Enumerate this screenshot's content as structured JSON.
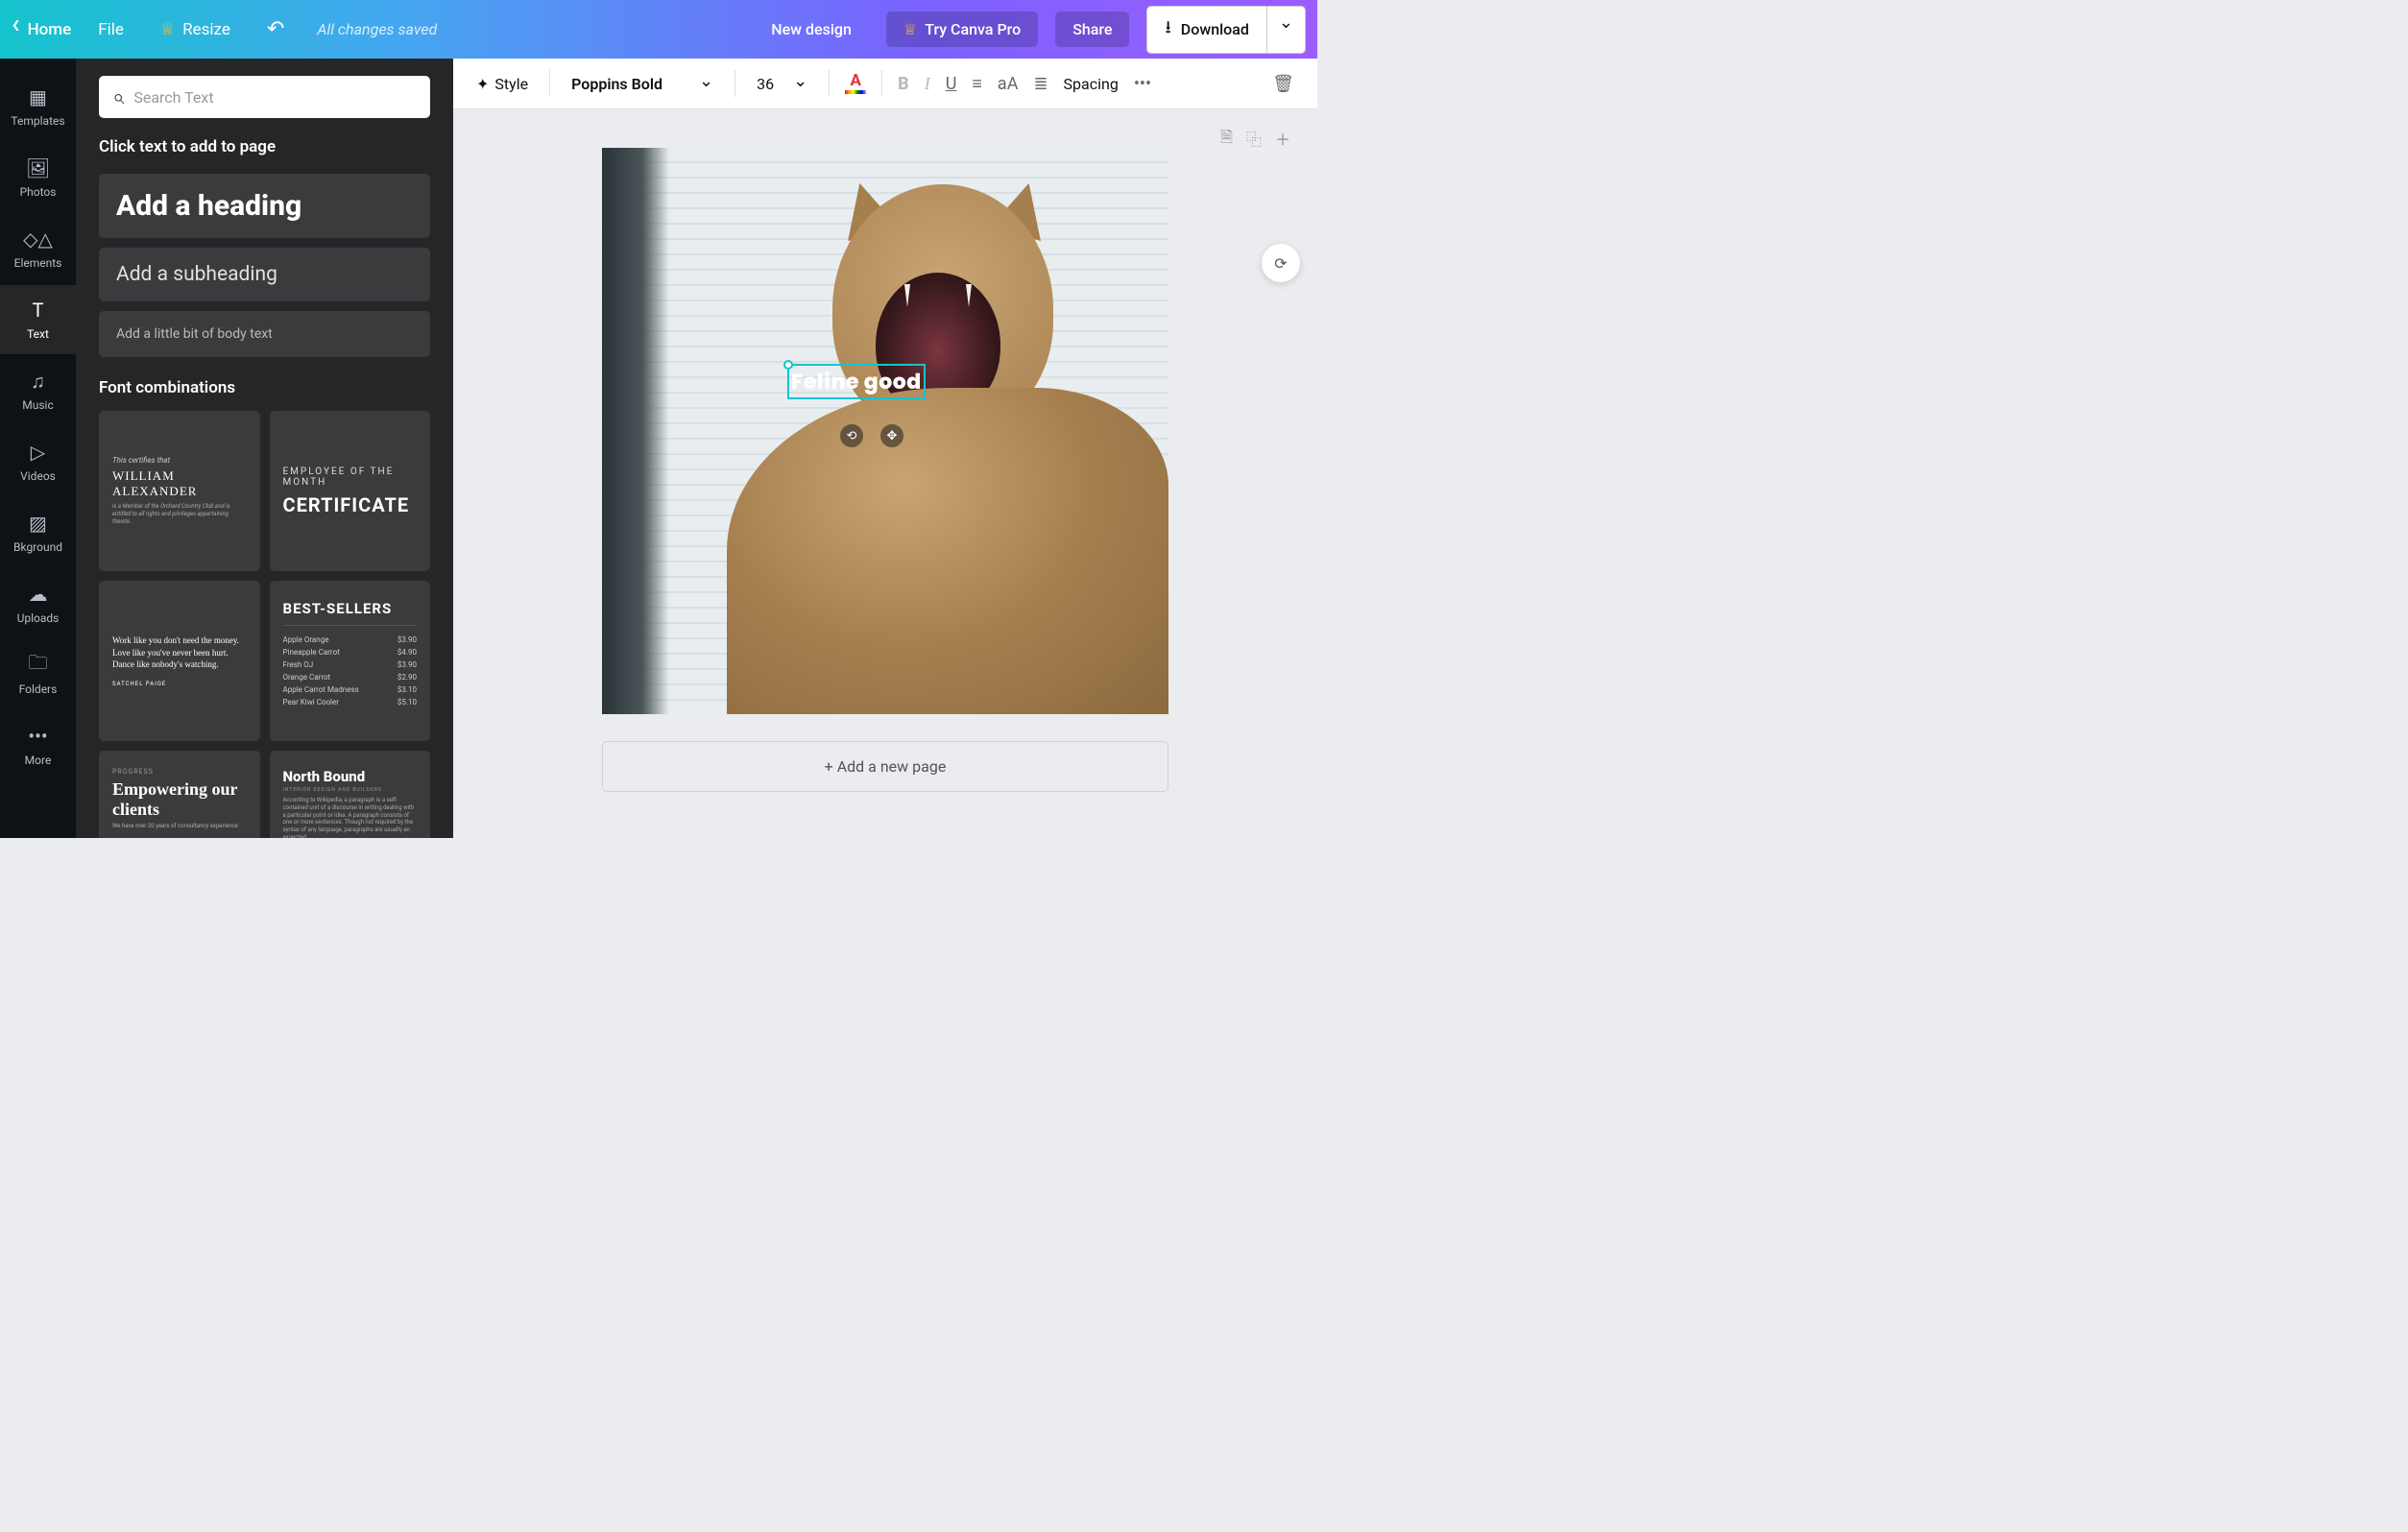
{
  "topbar": {
    "home": "Home",
    "file": "File",
    "resize": "Resize",
    "status": "All changes saved",
    "new_design": "New design",
    "try_pro": "Try Canva Pro",
    "share": "Share",
    "download": "Download"
  },
  "rail": {
    "templates": "Templates",
    "photos": "Photos",
    "elements": "Elements",
    "text": "Text",
    "music": "Music",
    "videos": "Videos",
    "bkground": "Bkground",
    "uploads": "Uploads",
    "folders": "Folders",
    "more": "More"
  },
  "panel": {
    "search_placeholder": "Search Text",
    "hint": "Click text to add to page",
    "add_heading": "Add a heading",
    "add_subheading": "Add a subheading",
    "add_body": "Add a little bit of body text",
    "combos_title": "Font combinations",
    "combos": [
      {
        "line1": "This certifies that",
        "line2": "WILLIAM ALEXANDER",
        "line3": "is a Member of the Orchard Country Club and is entitled to all rights and privileges appertaining thereto."
      },
      {
        "line1": "EMPLOYEE OF THE MONTH",
        "line2": "CERTIFICATE"
      },
      {
        "quote": "Work like you don't need the money. Love like you've never been hurt. Dance like nobody's watching.",
        "author": "SATCHEL PAIGE"
      },
      {
        "title": "BEST-SELLERS",
        "items": [
          {
            "name": "Apple Orange",
            "price": "$3.90"
          },
          {
            "name": "Pineapple Carrot",
            "price": "$4.90"
          },
          {
            "name": "Fresh OJ",
            "price": "$3.90"
          },
          {
            "name": "Orange Carrot",
            "price": "$2.90"
          },
          {
            "name": "Apple Carrot Madness",
            "price": "$3.10"
          },
          {
            "name": "Pear Kiwi Cooler",
            "price": "$5.10"
          }
        ]
      },
      {
        "line1": "PROGRESS",
        "line2": "Empowering our clients",
        "line3": "We have over 20 years of consultancy experience"
      },
      {
        "line1": "North Bound",
        "line2": "INTERIOR DESIGN AND BUILDERS",
        "line3": "According to Wikipedia, a paragraph is a self-contained unit of a discourse in writing dealing with a particular point or idea. A paragraph consists of one or more sentences. Though not required by the syntax of any language, paragraphs are usually an expected"
      }
    ]
  },
  "toolbar": {
    "style": "Style",
    "font": "Poppins Bold",
    "size": "36",
    "spacing": "Spacing"
  },
  "canvas": {
    "text_content": "Feline good",
    "add_page": "+ Add a new page"
  }
}
